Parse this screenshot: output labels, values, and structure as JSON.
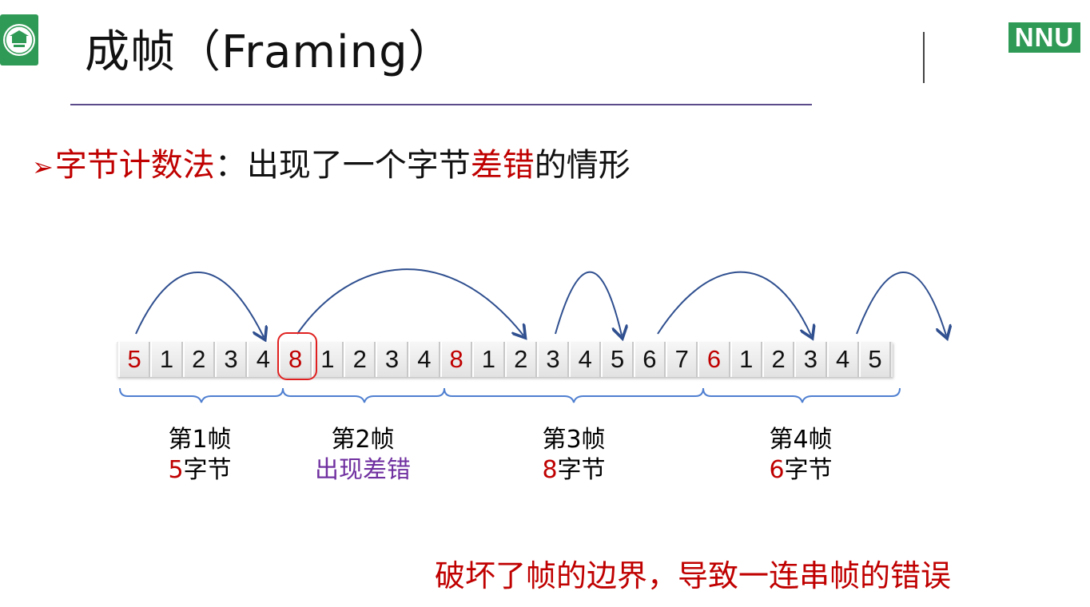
{
  "title": "成帧（Framing）",
  "logo_right": "NNU",
  "subtitle": {
    "bullet": "➢",
    "method": "字节计数法",
    "colon": "：",
    "text1": "出现了一个字节",
    "error_word": "差错",
    "text2": "的情形"
  },
  "bytes": [
    "5",
    "1",
    "2",
    "3",
    "4",
    "8",
    "1",
    "2",
    "3",
    "4",
    "8",
    "1",
    "2",
    "3",
    "4",
    "5",
    "6",
    "7",
    "6",
    "1",
    "2",
    "3",
    "4",
    "5"
  ],
  "count_indices": [
    0,
    5,
    10,
    18
  ],
  "error_index": 5,
  "frames": [
    {
      "name": "第1帧",
      "count": "5",
      "suffix": "字节"
    },
    {
      "name": "第2帧",
      "note": "出现差错"
    },
    {
      "name": "第3帧",
      "count": "8",
      "suffix": "字节"
    },
    {
      "name": "第4帧",
      "count": "6",
      "suffix": "字节"
    }
  ],
  "bottom_note": "破坏了帧的边界，导致一连串帧的错误",
  "colors": {
    "accent_red": "#c00000",
    "purple": "#7030a0",
    "arrow_blue": "#2f4f8f",
    "brace_blue": "#4f7fd0",
    "nnu_green": "#2f9a55"
  }
}
